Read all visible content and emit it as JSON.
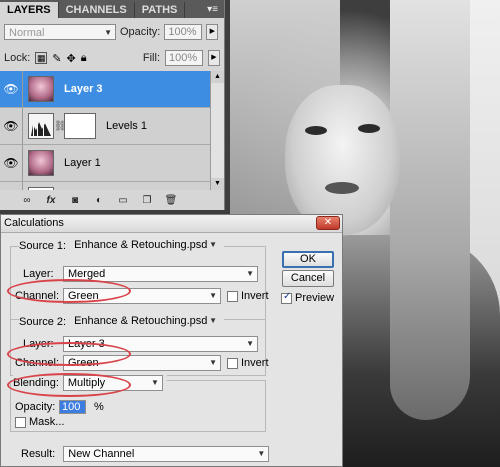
{
  "layers_panel": {
    "tabs": [
      "LAYERS",
      "CHANNELS",
      "PATHS"
    ],
    "menu_glyph": "▾≡",
    "blend_mode": "Normal",
    "opacity_label": "Opacity:",
    "opacity_value": "100%",
    "lock_label": "Lock:",
    "fill_label": "Fill:",
    "fill_value": "100%",
    "layers": [
      {
        "name": "Layer 3",
        "active": true
      },
      {
        "name": "Levels 1",
        "active": false
      },
      {
        "name": "Layer 1",
        "active": false
      }
    ],
    "footer_icons": [
      "link-icon",
      "fx-icon",
      "mask-icon",
      "adjustment-icon",
      "group-icon",
      "new-layer-icon",
      "trash-icon"
    ]
  },
  "dialog": {
    "title": "Calculations",
    "source1": {
      "label": "Source 1:",
      "value": "Enhance & Retouching.psd"
    },
    "layer1": {
      "label": "Layer:",
      "value": "Merged"
    },
    "channel1": {
      "label": "Channel:",
      "value": "Green",
      "invert": "Invert"
    },
    "source2": {
      "label": "Source 2:",
      "value": "Enhance & Retouching.psd"
    },
    "layer2": {
      "label": "Layer:",
      "value": "Layer 3"
    },
    "channel2": {
      "label": "Channel:",
      "value": "Green",
      "invert": "Invert"
    },
    "blending": {
      "label": "Blending:",
      "value": "Multiply"
    },
    "opacity": {
      "label": "Opacity:",
      "value": "100",
      "unit": "%"
    },
    "mask": "Mask...",
    "result": {
      "label": "Result:",
      "value": "New Channel"
    },
    "ok": "OK",
    "cancel": "Cancel",
    "preview": "Preview",
    "highlight_color": "#d8434a"
  }
}
